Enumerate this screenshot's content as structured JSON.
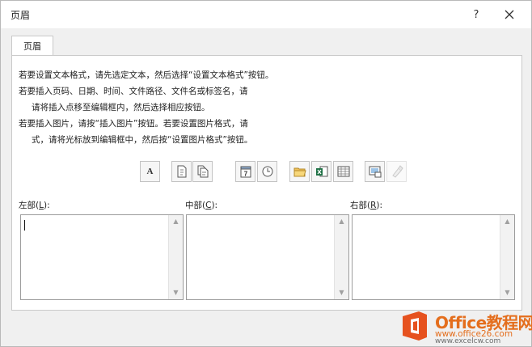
{
  "dialog": {
    "title": "页眉",
    "help_label": "?",
    "close_icon": "close-icon"
  },
  "tabs": [
    {
      "label": "页眉"
    }
  ],
  "instructions": {
    "line1": "若要设置文本格式，请先选定文本，然后选择“设置文本格式”按钮。",
    "line2": "若要插入页码、日期、时间、文件路径、文件名或标签名，请",
    "line3": "请将插入点移至编辑框内，然后选择相应按钮。",
    "line4": "若要插入图片，请按“插入图片”按钮。若要设置图片格式，请",
    "line5": "式，请将光标放到编辑框中，然后按“设置图片格式”按钮。"
  },
  "toolbar": {
    "buttons": [
      {
        "icon": "format-text-icon",
        "glyph": "A"
      },
      {
        "icon": "page-number-icon"
      },
      {
        "icon": "number-of-pages-icon"
      },
      {
        "icon": "date-icon"
      },
      {
        "icon": "time-icon"
      },
      {
        "icon": "file-path-icon"
      },
      {
        "icon": "file-name-icon"
      },
      {
        "icon": "sheet-name-icon"
      },
      {
        "icon": "insert-picture-icon"
      },
      {
        "icon": "format-picture-icon",
        "disabled": true
      }
    ],
    "date_glyph": "7"
  },
  "sections": {
    "left": {
      "label_prefix": "左部(",
      "key": "L",
      "label_suffix": "):"
    },
    "center": {
      "label_prefix": "中部(",
      "key": "C",
      "label_suffix": "):"
    },
    "right": {
      "label_prefix": "右部(",
      "key": "R",
      "label_suffix": "):"
    }
  },
  "watermark": {
    "brand": "Office教程网",
    "url": "www.office26.com",
    "url2": "www.excelcw.com"
  }
}
